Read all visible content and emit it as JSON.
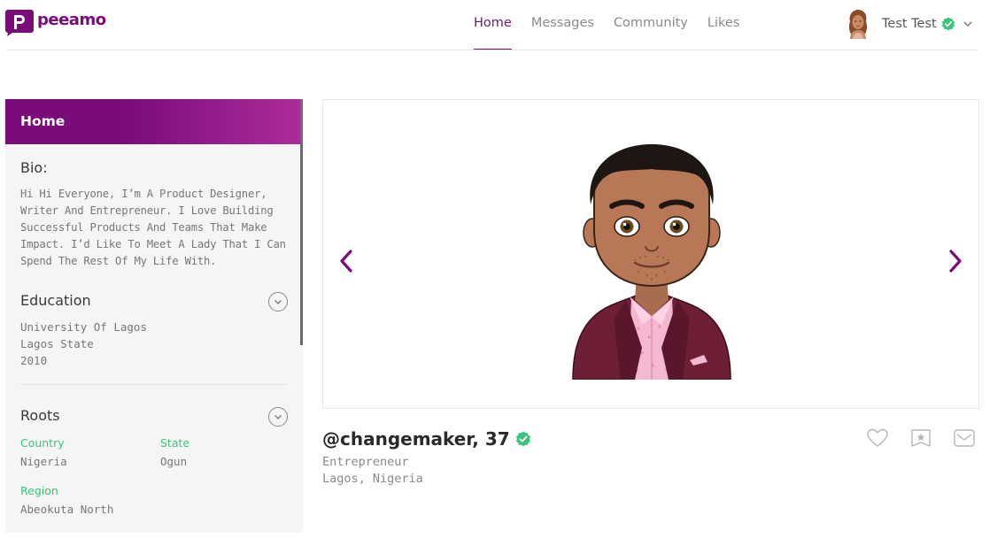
{
  "brand": {
    "name": "peeamo",
    "color": "#7a0c7a"
  },
  "nav": {
    "items": [
      {
        "label": "Home",
        "active": true
      },
      {
        "label": "Messages",
        "active": false
      },
      {
        "label": "Community",
        "active": false
      },
      {
        "label": "Likes",
        "active": false
      }
    ]
  },
  "user": {
    "name": "Test Test",
    "verified": true
  },
  "sidebar": {
    "header": "Home",
    "bio": {
      "title": "Bio:",
      "text": "Hi Hi Everyone, I’m A Product Designer, Writer And Entrepreneur. I Love Building Successful Products And Teams That Make Impact. I’d Like To Meet A Lady That I Can Spend The Rest Of My Life With."
    },
    "education": {
      "title": "Education",
      "school": "University Of Lagos",
      "state": "Lagos State",
      "year": "2010"
    },
    "roots": {
      "title": "Roots",
      "country_label": "Country",
      "country": "Nigeria",
      "state_label": "State",
      "state": "Ogun",
      "region_label": "Region",
      "region": "Abeokuta North"
    }
  },
  "profile": {
    "name": "@changemaker, 37",
    "verified": true,
    "occupation": "Entrepreneur",
    "location": "Lagos, Nigeria"
  },
  "colors": {
    "accent": "#7a0c7a",
    "verified": "#3ac47d",
    "label_green": "#3ac47d"
  },
  "icons": [
    "logo-icon",
    "user-avatar",
    "verified-icon",
    "chevron-down-icon",
    "chevron-left-icon",
    "chevron-right-icon",
    "heart-icon",
    "bookmark-star-icon",
    "mail-icon"
  ]
}
